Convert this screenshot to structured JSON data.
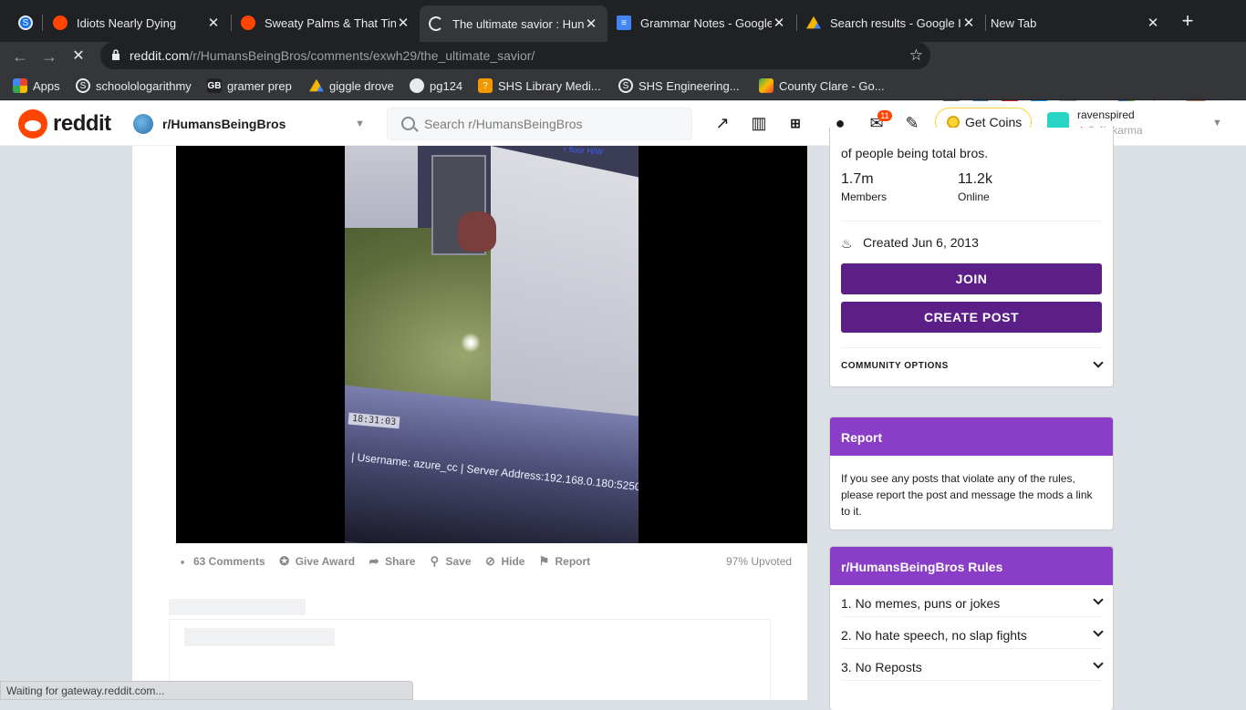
{
  "browser": {
    "tabs": [
      {
        "title": "Idiots Nearly Dying",
        "icon": "reddit-icon"
      },
      {
        "title": "Sweaty Palms & That Tin",
        "icon": "reddit-icon"
      },
      {
        "title": "The ultimate savior : Hun",
        "icon": "loading-icon",
        "active": true
      },
      {
        "title": "Grammar Notes - Google",
        "icon": "google-docs-icon"
      },
      {
        "title": "Search results - Google I",
        "icon": "google-drive-icon"
      },
      {
        "title": "New Tab",
        "icon": "blank-icon"
      }
    ],
    "url_domain": "reddit.com",
    "url_path": "/r/HumansBeingBros/comments/exwh29/the_ultimate_savior/",
    "bookmarks": [
      {
        "label": "Apps",
        "icon": "apps-grid-icon"
      },
      {
        "label": "schoolologarithmy",
        "icon": "schoology-icon"
      },
      {
        "label": "gramer prep",
        "icon": "gb-icon"
      },
      {
        "label": "giggle drove",
        "icon": "google-drive-icon"
      },
      {
        "label": "pg124",
        "icon": "globe-icon"
      },
      {
        "label": "SHS Library Medi...",
        "icon": "library-icon"
      },
      {
        "label": "SHS Engineering...",
        "icon": "schoology-icon"
      },
      {
        "label": "County Clare - Go...",
        "icon": "map-icon"
      }
    ],
    "status_text": "Waiting for gateway.reddit.com..."
  },
  "reddit_header": {
    "wordmark": "reddit",
    "subreddit": "r/HumansBeingBros",
    "search_placeholder": "Search r/HumansBeingBros",
    "notification_count": "11",
    "coins_label": "Get Coins",
    "username": "ravenspired",
    "karma": "2.4k karma"
  },
  "post": {
    "video": {
      "timestamp": "18:31:03",
      "osd_text": "| Username: azure_cc | Server Address:192.168.0.180:5250",
      "corner_text": "r floor H/W"
    },
    "actions": {
      "comments": "63 Comments",
      "award": "Give Award",
      "share": "Share",
      "save": "Save",
      "hide": "Hide",
      "report": "Report"
    },
    "upvoted": "97% Upvoted"
  },
  "sidebar": {
    "about": {
      "description_tail": "of people being total bros.",
      "members_value": "1.7m",
      "members_label": "Members",
      "online_value": "11.2k",
      "online_label": "Online",
      "created": "Created Jun 6, 2013",
      "join_label": "JOIN",
      "create_post_label": "CREATE POST",
      "community_options_label": "COMMUNITY OPTIONS"
    },
    "report": {
      "title": "Report",
      "body": "If you see any posts that violate any of the rules, please report the post and message the mods a link to it."
    },
    "rules": {
      "title": "r/HumansBeingBros Rules",
      "items": [
        {
          "label": "1. No memes, puns or jokes"
        },
        {
          "label": "2. No hate speech, no slap fights"
        },
        {
          "label": "3. No Reposts"
        }
      ]
    }
  },
  "colors": {
    "reddit_orange": "#ff4500",
    "join_button": "#5c1f87",
    "card_header": "#8a3ec8",
    "page_bg": "#dae0e6"
  }
}
